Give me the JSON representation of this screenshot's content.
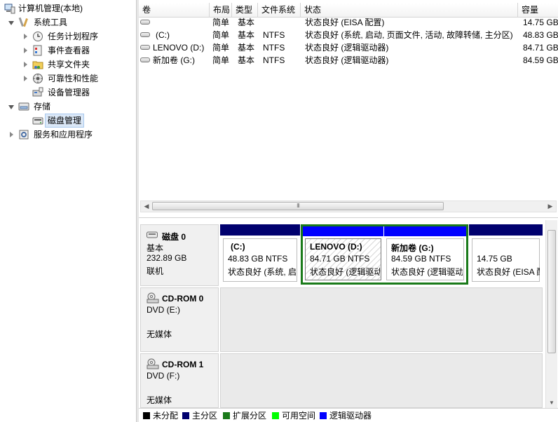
{
  "tree": {
    "root": "计算机管理(本地)",
    "system_tools": "系统工具",
    "task_scheduler": "任务计划程序",
    "event_viewer": "事件查看器",
    "shared_folders": "共享文件夹",
    "reliability": "可靠性和性能",
    "device_manager": "设备管理器",
    "storage": "存储",
    "disk_management": "磁盘管理",
    "services_apps": "服务和应用程序"
  },
  "volume_table": {
    "headers": [
      "卷",
      "布局",
      "类型",
      "文件系统",
      "状态",
      "容量"
    ],
    "rows": [
      [
        "",
        "简单",
        "基本",
        "",
        "状态良好 (EISA 配置)",
        "14.75 GB"
      ],
      [
        "(C:)",
        "简单",
        "基本",
        "NTFS",
        "状态良好 (系统, 启动, 页面文件, 活动, 故障转储, 主分区)",
        "48.83 GB"
      ],
      [
        "LENOVO (D:)",
        "简单",
        "基本",
        "NTFS",
        "状态良好 (逻辑驱动器)",
        "84.71 GB"
      ],
      [
        "新加卷 (G:)",
        "简单",
        "基本",
        "NTFS",
        "状态良好 (逻辑驱动器)",
        "84.59 GB"
      ]
    ]
  },
  "scrollbar": {
    "thumb_grip": "III"
  },
  "disks": {
    "disk0": {
      "name": "磁盘 0",
      "type": "基本",
      "size": "232.89 GB",
      "status": "联机",
      "partitions": [
        {
          "label": "(C:)",
          "size": "48.83 GB NTFS",
          "status": "状态良好 (系统, 启",
          "bar_color": "#00006e"
        },
        {
          "label": "LENOVO  (D:)",
          "size": "84.71 GB NTFS",
          "status": "状态良好 (逻辑驱动",
          "bar_color": "#0000ff"
        },
        {
          "label": "新加卷  (G:)",
          "size": "84.59 GB NTFS",
          "status": "状态良好 (逻辑驱动",
          "bar_color": "#0000ff"
        },
        {
          "label": "",
          "size": "14.75 GB",
          "status": "状态良好 (EISA 配",
          "bar_color": "#00006e"
        }
      ],
      "extended_border": "#1a7a1a"
    },
    "cdrom0": {
      "name": "CD-ROM 0",
      "drive": "DVD (E:)",
      "media": "无媒体"
    },
    "cdrom1": {
      "name": "CD-ROM 1",
      "drive": "DVD (F:)",
      "media": "无媒体"
    }
  },
  "legend": [
    {
      "label": "未分配",
      "color": "#000000"
    },
    {
      "label": "主分区",
      "color": "#00006e"
    },
    {
      "label": "扩展分区",
      "color": "#1a7a1a"
    },
    {
      "label": "可用空间",
      "color": "#00ff00"
    },
    {
      "label": "逻辑驱动器",
      "color": "#0000ff"
    }
  ]
}
